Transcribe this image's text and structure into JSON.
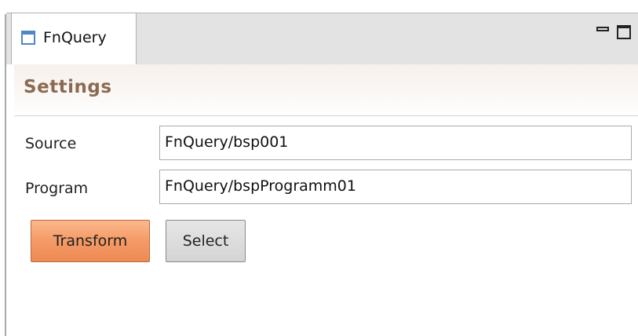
{
  "tab": {
    "label": "FnQuery",
    "icon": "window-icon"
  },
  "window_controls": {
    "minimize_icon": "minimize-icon",
    "maximize_icon": "maximize-icon"
  },
  "settings": {
    "title": "Settings"
  },
  "form": {
    "source_label": "Source",
    "source_value": "FnQuery/bsp001",
    "program_label": "Program",
    "program_value": "FnQuery/bspProgramm01"
  },
  "buttons": {
    "transform_label": "Transform",
    "select_label": "Select"
  },
  "colors": {
    "accent": "#f49a66",
    "title": "#8b6a52",
    "tab_icon": "#4e86c6"
  }
}
